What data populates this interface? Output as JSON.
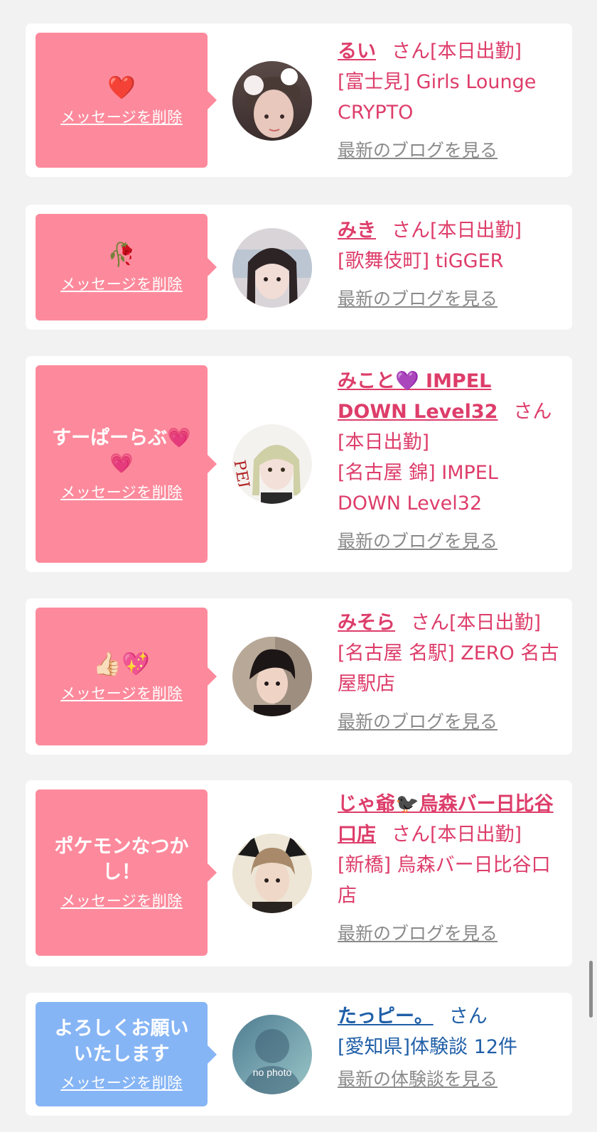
{
  "delete_label": "メッセージを削除",
  "san_label": "さん",
  "cards": [
    {
      "message": "❤️",
      "name": "るい",
      "status": "[本日出勤]",
      "shop": "[富士見] Girls Lounge CRYPTO",
      "link": "最新のブログを見る"
    },
    {
      "message": "🥀",
      "name": "みき",
      "status": "[本日出勤]",
      "shop": "[歌舞伎町] tiGGER",
      "link": "最新のブログを見る"
    },
    {
      "message": "すーぱーらぶ💗💗",
      "name": "みこと💜 IMPEL DOWN Level32",
      "status": "[本日出勤]",
      "shop": "[名古屋 錦] IMPEL DOWN Level32",
      "link": "最新のブログを見る"
    },
    {
      "message": "👍🏻💖",
      "name": "みそら",
      "status": "[本日出勤]",
      "shop": "[名古屋 名駅] ZERO 名古屋駅店",
      "link": "最新のブログを見る"
    },
    {
      "message": "ポケモンなつかし！",
      "name": "じゃ爺🐦‍⬛烏森バー日比谷口店",
      "status": "[本日出勤]",
      "shop": "[新橋] 烏森バー日比谷口店",
      "link": "最新のブログを見る"
    },
    {
      "message": "よろしくお願いいたします",
      "name": "たっピー。",
      "status": "",
      "shop": "[愛知県]体験談 12件",
      "link": "最新の体験談を見る",
      "avatar_text": "no photo"
    }
  ],
  "colors": {
    "pink_bubble": "#fd8a9c",
    "blue_bubble": "#86b5f5",
    "cast_text": "#dd3d6a",
    "user_text": "#205fa8",
    "link_gray": "#8a8a8a"
  }
}
